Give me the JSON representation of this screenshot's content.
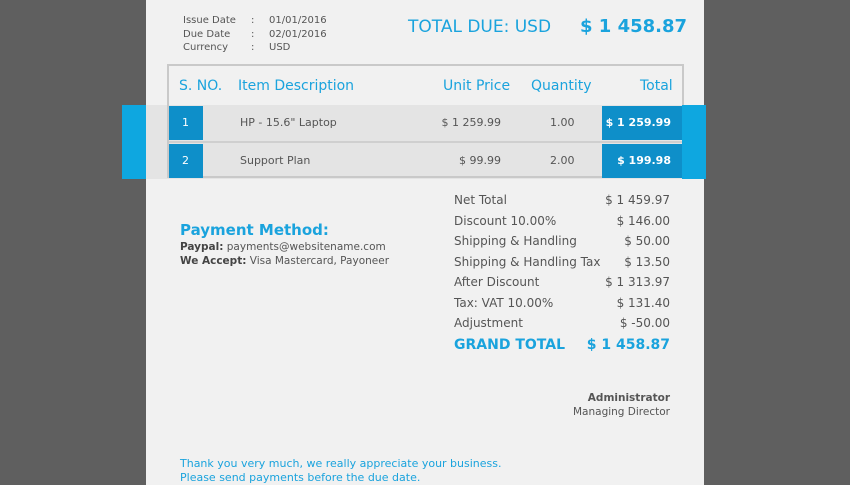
{
  "invoice": {
    "meta": [
      {
        "label": "Issue Date",
        "sep": ":",
        "value": "01/01/2016"
      },
      {
        "label": "Due Date",
        "sep": ":",
        "value": "02/01/2016"
      },
      {
        "label": "Currency",
        "sep": ":",
        "value": "USD"
      }
    ],
    "total_due_label": "TOTAL DUE: USD",
    "total_due_value": "$ 1 458.87",
    "table": {
      "headers": {
        "sno": "S. NO.",
        "desc": "Item Description",
        "price": "Unit Price",
        "qty": "Quantity",
        "total": "Total"
      },
      "rows": [
        {
          "sno": "1",
          "desc": "HP - 15.6\" Laptop",
          "price": "$ 1 259.99",
          "qty": "1.00",
          "total": "$ 1 259.99"
        },
        {
          "sno": "2",
          "desc": "Support Plan",
          "price": "$ 99.99",
          "qty": "2.00",
          "total": "$ 199.98"
        }
      ]
    },
    "payment": {
      "title": "Payment Method:",
      "paypal_label": "Paypal:",
      "paypal_value": "payments@websitename.com",
      "accept_label": "We Accept:",
      "accept_value": "Visa Mastercard, Payoneer"
    },
    "summary": [
      {
        "label": "Net Total",
        "value": "$ 1 459.97"
      },
      {
        "label": "Discount 10.00%",
        "value": "$ 146.00"
      },
      {
        "label": "Shipping & Handling",
        "value": "$ 50.00"
      },
      {
        "label": "Shipping & Handling Tax",
        "value": "$ 13.50"
      },
      {
        "label": "After Discount",
        "value": "$ 1 313.97"
      },
      {
        "label": "Tax: VAT 10.00%",
        "value": "$ 131.40"
      },
      {
        "label": "Adjustment",
        "value": "$ -50.00"
      }
    ],
    "grand_total_label": "GRAND TOTAL",
    "grand_total_value": "$ 1 458.87",
    "signature": {
      "name": "Administrator",
      "title": "Managing Director"
    },
    "footer": [
      "Thank you very much, we really appreciate your business.",
      "Please send payments before the due date."
    ]
  },
  "colors": {
    "accent": "#1aa3dd",
    "cell_blue": "#0e8fc9",
    "edge_blue": "#0ea7e0",
    "backdrop": "#5f5f5f",
    "paper": "#f1f1f1"
  }
}
